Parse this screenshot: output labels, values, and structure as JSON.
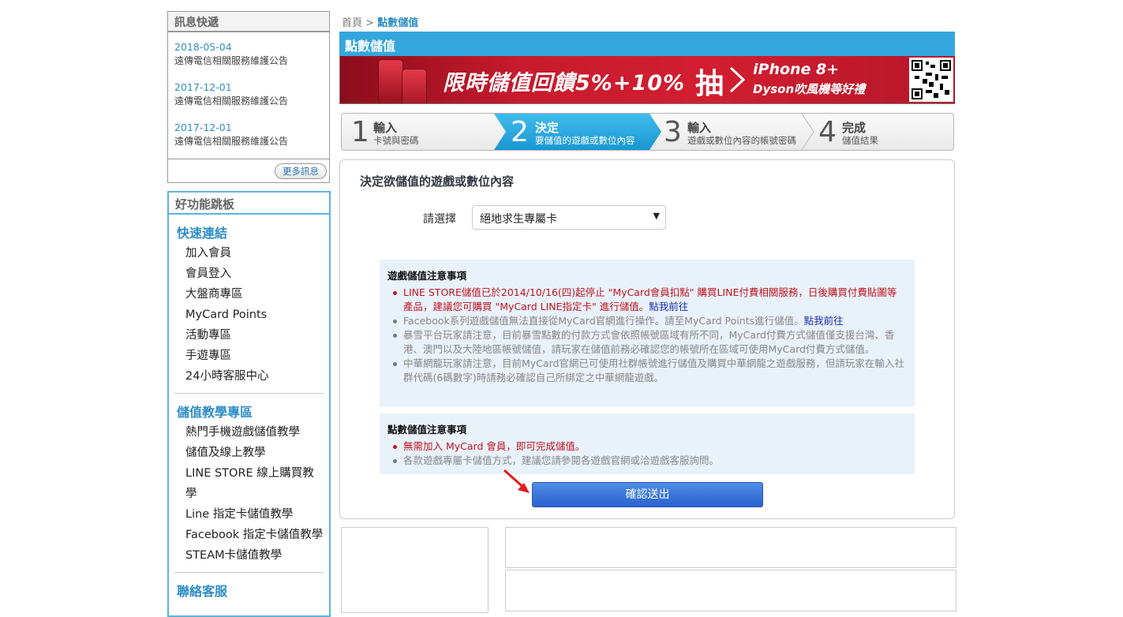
{
  "news": {
    "header": "訊息快遞",
    "items": [
      {
        "date": "2018-05-04",
        "title": "遠傳電信相關服務維護公告"
      },
      {
        "date": "2017-12-01",
        "title": "遠傳電信相關服務維護公告"
      },
      {
        "date": "2017-12-01",
        "title": "遠傳電信相關服務維護公告"
      }
    ],
    "more_label": "更多訊息"
  },
  "shortcuts": {
    "header": "好功能跳板",
    "quick_links_title": "快速連結",
    "quick_links": [
      "加入會員",
      "會員登入",
      "大盤商專區",
      "MyCard Points",
      "活動專區",
      "手遊專區",
      "24小時客服中心"
    ],
    "tutorials_title": "儲值教學專區",
    "tutorials": [
      "熱門手機遊戲儲值教學",
      "儲值及線上教學",
      "LINE STORE 線上購買教學",
      "Line 指定卡儲值教學",
      "Facebook 指定卡儲值教學",
      "STEAM卡儲值教學"
    ],
    "contact_title": "聯絡客服"
  },
  "breadcrumb": {
    "home": "首頁",
    "sep": ">",
    "current": "點數儲值"
  },
  "main_title": "點數儲值",
  "banner": {
    "headline": "限時儲值回饋5%+10%",
    "draw": "抽",
    "prize1": "iPhone 8+",
    "prize2": "Dyson吹風機等好禮"
  },
  "steps": [
    {
      "num": "1",
      "title": "輸入",
      "desc": "卡號與密碼",
      "active": false
    },
    {
      "num": "2",
      "title": "決定",
      "desc": "要儲值的遊戲或數位內容",
      "active": true
    },
    {
      "num": "3",
      "title": "輸入",
      "desc": "遊戲或數位內容的帳號密碼",
      "active": false
    },
    {
      "num": "4",
      "title": "完成",
      "desc": "儲值結果",
      "active": false
    }
  ],
  "panel": {
    "title": "決定欲儲值的遊戲或數位內容",
    "select_label": "請選擇",
    "select_value": "絕地求生專屬卡",
    "game_notice": {
      "title": "遊戲儲值注意事項",
      "items": [
        {
          "text": "LINE STORE儲值已於2014/10/16(四)起停止 \"MyCard會員扣點\" 購買LINE付費相關服務，日後購買付費貼圖等產品，建議您可購買 \"MyCard LINE指定卡\" 進行儲值。",
          "link": "點我前往",
          "red": true
        },
        {
          "text": "Facebook系列遊戲儲值無法直接從MyCard官網進行操作。請至MyCard Points進行儲值。",
          "link": "點我前往",
          "red": false
        },
        {
          "text": "暴雪平台玩家請注意，目前暴雪點數的付款方式會依照帳號區域有所不同，MyCard付費方式儲值僅支援台灣、香港、澳門以及大陸地區帳號儲值，請玩家在儲值前務必確認您的帳號所在區域可使用MyCard付費方式儲值。",
          "link": "",
          "red": false
        },
        {
          "text": "中華網龍玩家請注意，目前MyCard官網已可使用社群帳號進行儲值及購買中華網龍之遊戲服務，但請玩家在輸入社群代碼(6碼數字)時請務必確認自己所綁定之中華網龍遊戲。",
          "link": "",
          "red": false
        }
      ]
    },
    "points_notice": {
      "title": "點數儲值注意事項",
      "items": [
        {
          "text": "無需加入 MyCard 會員，即可完成儲值。",
          "red": true
        },
        {
          "text": "各款遊戲專屬卡儲值方式，建議您請參閱各遊戲官網或洽遊戲客服詢問。",
          "red": false
        }
      ]
    },
    "confirm_label": "確認送出"
  },
  "colors": {
    "accent": "#35a6dd",
    "link": "#2e8ec6",
    "button": "#3a78dc",
    "alert": "#c0151f"
  }
}
